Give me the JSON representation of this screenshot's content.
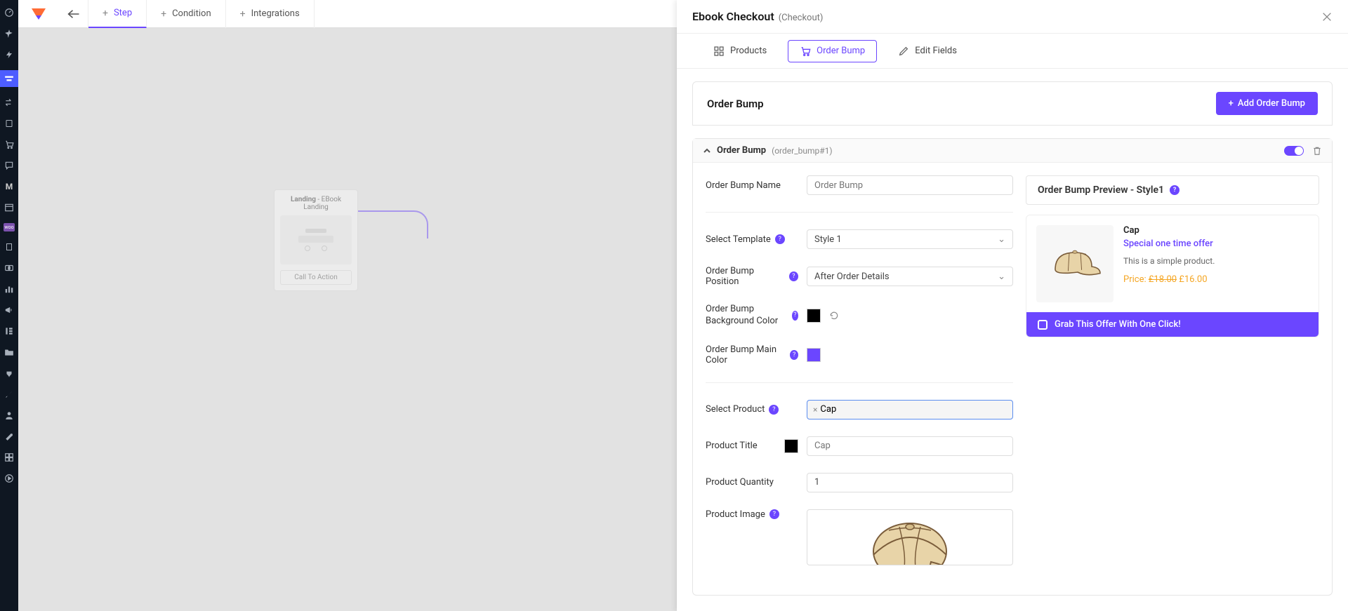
{
  "header": {
    "tabs": {
      "step": "Step",
      "condition": "Condition",
      "integrations": "Integrations"
    }
  },
  "canvas": {
    "card_title_a": "Landing",
    "card_title_b": " - EBook Landing",
    "cta": "Call To Action"
  },
  "panel": {
    "title": "Ebook Checkout",
    "subtitle": "(Checkout)",
    "subtabs": {
      "products": "Products",
      "order_bump": "Order Bump",
      "edit_fields": "Edit Fields"
    },
    "section_title": "Order Bump",
    "add_btn": "Add Order Bump",
    "card": {
      "title": "Order Bump",
      "id": "(order_bump#1)",
      "form": {
        "name_label": "Order Bump Name",
        "name_placeholder": "Order Bump",
        "template_label": "Select Template",
        "template_value": "Style 1",
        "position_label": "Order Bump Position",
        "position_value": "After Order Details",
        "bg_label": "Order Bump Background Color",
        "main_label": "Order Bump Main Color",
        "product_label": "Select Product",
        "product_tag": "Cap",
        "ptitle_label": "Product Title",
        "ptitle_placeholder": "Cap",
        "qty_label": "Product Quantity",
        "qty_value": "1",
        "img_label": "Product Image"
      }
    },
    "preview": {
      "heading": "Order Bump Preview - Style1",
      "ptitle": "Cap",
      "offer": "Special one time offer",
      "desc": "This is a simple product.",
      "price_label": "Price: ",
      "old_price": "£18.00",
      "new_price": "£16.00",
      "cta": "Grab This Offer With One Click!"
    }
  },
  "colors": {
    "bg": "#000000",
    "main": "#6b46ff"
  }
}
